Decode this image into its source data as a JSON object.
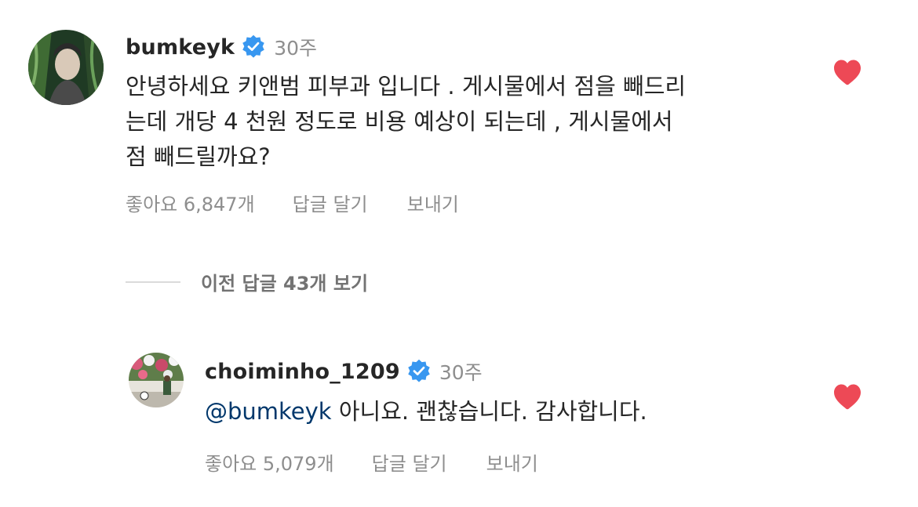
{
  "comments": [
    {
      "username": "bumkeyk",
      "time": "30주",
      "text": "안녕하세요 키앤범 피부과 입니다 . 게시물에서 점을 빼드리\n는데 개당 4 천원 정도로 비용 예상이 되는데 , 게시물에서\n점 빼드릴까요?",
      "likes_label": "좋아요 6,847개",
      "reply_label": "답글 달기",
      "send_label": "보내기"
    }
  ],
  "view_replies_label": "이전 답글 43개 보기",
  "reply": {
    "username": "choiminho_1209",
    "time": "30주",
    "mention": "@bumkeyk",
    "text": " 아니요. 괜찮습니다. 감사합니다.",
    "likes_label": "좋아요 5,079개",
    "reply_label": "답글 달기",
    "send_label": "보내기"
  },
  "colors": {
    "verified_badge": "#3897f0",
    "heart": "#ed4956",
    "mention": "#00376b",
    "meta_text": "#8e8e8e"
  },
  "icons": {
    "verified": "verified-badge-icon",
    "like": "heart-filled-icon"
  }
}
